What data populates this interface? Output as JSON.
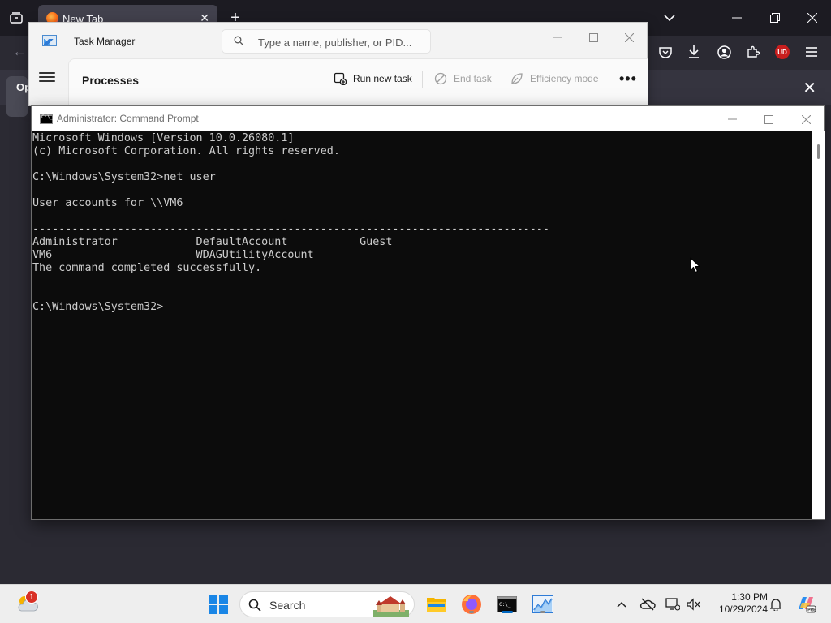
{
  "firefox": {
    "tab_label": "New Tab",
    "notification_badge": "Op",
    "ublock_badge": "UD"
  },
  "task_manager": {
    "title": "Task Manager",
    "search_placeholder": "Type a name, publisher, or PID...",
    "page_heading": "Processes",
    "commands": {
      "run_new_task": "Run new task",
      "end_task": "End task",
      "efficiency_mode": "Efficiency mode",
      "more": "•••"
    }
  },
  "command_prompt": {
    "title": "Administrator: Command Prompt",
    "output": "Microsoft Windows [Version 10.0.26080.1]\n(c) Microsoft Corporation. All rights reserved.\n\nC:\\Windows\\System32>net user\n\nUser accounts for \\\\VM6\n\n-------------------------------------------------------------------------------\nAdministrator            DefaultAccount           Guest\nVM6                      WDAGUtilityAccount\nThe command completed successfully.\n\n\nC:\\Windows\\System32>"
  },
  "taskbar": {
    "search_label": "Search",
    "weather_badge_count": "1",
    "clock_time": "1:30 PM",
    "clock_date": "10/29/2024"
  },
  "icons": {
    "firefox_tabbar": [
      "tab-overview-icon",
      "firefox-favicon",
      "close-icon",
      "new-tab-icon",
      "chevron-down-icon"
    ],
    "firefox_toolbar": [
      "back-arrow-icon",
      "pocket-icon",
      "download-icon",
      "account-icon",
      "extensions-icon",
      "ublock-icon",
      "hamburger-menu-icon"
    ],
    "taskbar": [
      "weather-icon",
      "windows-start-icon",
      "search-icon",
      "file-explorer-icon",
      "firefox-icon",
      "command-prompt-icon",
      "task-manager-icon",
      "chevron-up-icon",
      "onedrive-icon",
      "network-icon",
      "volume-icon",
      "bell-icon",
      "copilot-icon"
    ]
  },
  "colors": {
    "cmd_background": "#0c0c0c",
    "cmd_text": "#cccccc",
    "firefox_dark": "#1c1b22",
    "taskbar": "#eeeeee",
    "accent_blue": "#0067c0"
  }
}
